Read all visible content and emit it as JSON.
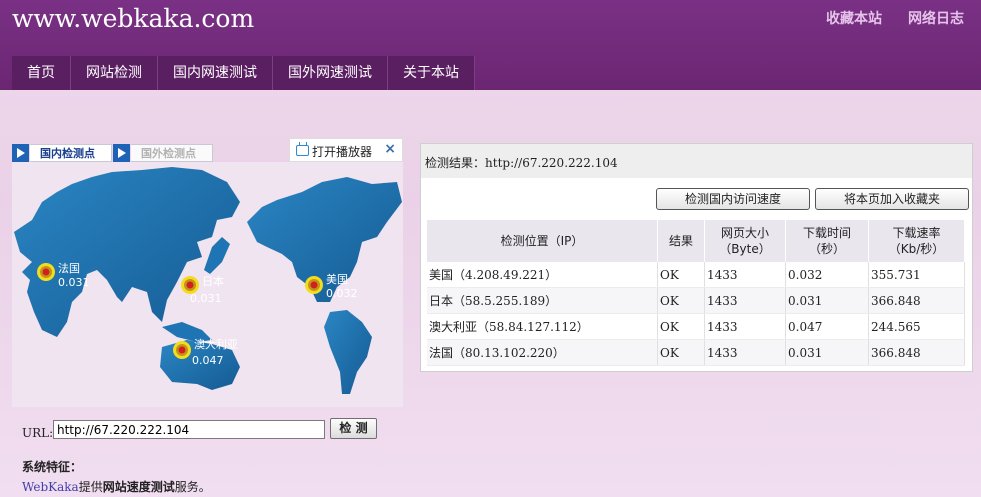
{
  "header": {
    "logo": "www.webkaka.com",
    "links": [
      "收藏本站",
      "网络日志"
    ]
  },
  "nav": [
    "首页",
    "网站检测",
    "国内网速测试",
    "国外网速测试",
    "关于本站"
  ],
  "map_panel": {
    "tabs": [
      "国内检测点",
      "国外检测点"
    ],
    "player_button": "打开播放器",
    "close_label": "×",
    "pins": [
      {
        "name": "法国",
        "time": "0.031"
      },
      {
        "name": "日本",
        "time": "0.031"
      },
      {
        "name": "美国",
        "time": "0.032"
      },
      {
        "name": "澳大利亚",
        "time": "0.047"
      }
    ]
  },
  "url_form": {
    "label": "URL:",
    "value": "http://67.220.222.104",
    "button": "检 测"
  },
  "features": {
    "title": "系统特征：",
    "link": "WebKaka",
    "text_before": "提供",
    "text_bold": "网站速度测试",
    "text_after": "服务。"
  },
  "result": {
    "label": "检测结果：",
    "url": "http://67.220.222.104",
    "buttons": [
      "检测国内访问速度",
      "将本页加入收藏夹"
    ],
    "columns": [
      "检测位置（IP）",
      "结果",
      "网页大小（Byte）",
      "下载时间（秒）",
      "下载速率（Kb/秒）"
    ],
    "col_lines": [
      [
        "检测位置（IP）"
      ],
      [
        "结果"
      ],
      [
        "网页大小",
        "（Byte）"
      ],
      [
        "下载时间",
        "（秒）"
      ],
      [
        "下载速率",
        "（Kb/秒）"
      ]
    ],
    "rows": [
      {
        "loc": "美国",
        "ip": "（4.208.49.221）",
        "result": "OK",
        "size": "1433",
        "time": "0.032",
        "rate": "355.731"
      },
      {
        "loc": "日本",
        "ip": "（58.5.255.189）",
        "result": "OK",
        "size": "1433",
        "time": "0.031",
        "rate": "366.848"
      },
      {
        "loc": "澳大利亚",
        "ip": "（58.84.127.112）",
        "result": "OK",
        "size": "1433",
        "time": "0.047",
        "rate": "244.565"
      },
      {
        "loc": "法国",
        "ip": "（80.13.102.220）",
        "result": "OK",
        "size": "1433",
        "time": "0.031",
        "rate": "366.848"
      }
    ]
  },
  "colors": {
    "header": "#6b2672",
    "nav": "#5a1f61",
    "map_ocean": "#f2e6f2",
    "land": "#1d6aa6",
    "pin": "#e8d21e"
  }
}
